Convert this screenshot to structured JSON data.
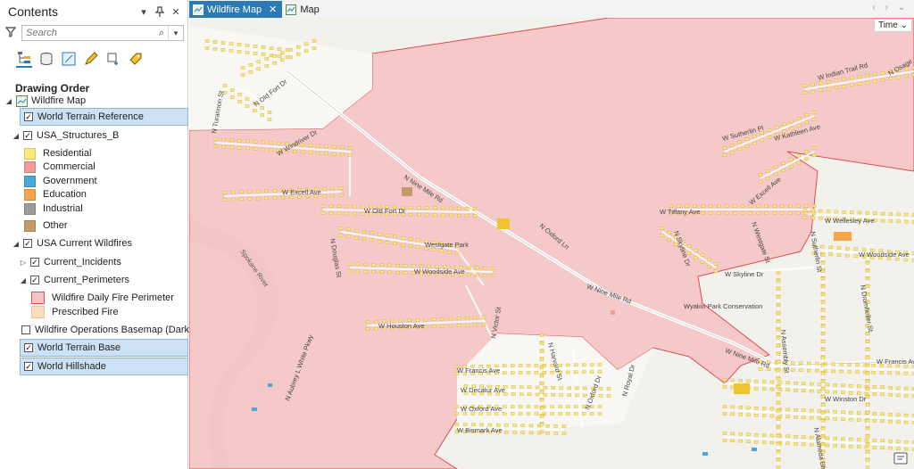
{
  "contents": {
    "title": "Contents",
    "search_placeholder": "Search",
    "drawing_order_label": "Drawing Order",
    "header_icons": [
      "chevron-down-icon",
      "pin-icon",
      "close-icon"
    ],
    "tools": [
      "drawing-order-icon",
      "data-source-icon",
      "selection-icon",
      "editing-icon",
      "snapping-icon",
      "labeling-icon"
    ]
  },
  "layers": {
    "map_name": "Wildfire Map",
    "world_terrain_reference": "World Terrain Reference",
    "usa_structures": "USA_Structures_B",
    "structure_classes": [
      {
        "label": "Residential",
        "color": "#fde87a"
      },
      {
        "label": "Commercial",
        "color": "#f49a9a"
      },
      {
        "label": "Government",
        "color": "#4aa7d9"
      },
      {
        "label": "Education",
        "color": "#f7a54a"
      },
      {
        "label": "Industrial",
        "color": "#9b9b9b"
      },
      {
        "label": "Other",
        "color": "#c59a6b"
      }
    ],
    "usa_current_wildfires": "USA Current Wildfires",
    "current_incidents": "Current_Incidents",
    "current_perimeters": "Current_Perimeters",
    "perimeter_classes": [
      {
        "label": "Wildfire Daily Fire Perimeter",
        "color": "#f4c4c4",
        "border": "#e05050"
      },
      {
        "label": "Prescribed Fire",
        "color": "#f6dcc0",
        "border": "#e8c39c"
      }
    ],
    "basemap_dark": "Wildfire Operations Basemap (Dark)",
    "world_terrain_base": "World Terrain Base",
    "world_hillshade": "World Hillshade"
  },
  "tabs": [
    {
      "label": "Wildfire Map",
      "active": true
    },
    {
      "label": "Map",
      "active": false
    }
  ],
  "time_label": "Time",
  "colors": {
    "accent": "#2a7ab6",
    "fire_fill": "#f5c6c6",
    "fire_edge": "#e04b4b",
    "river": "#cbc8d6",
    "residential": "#fde87a"
  },
  "map_labels": {
    "streets": [
      "N Old Fort Dr",
      "N Turannon St",
      "W Windriver Dr",
      "N Nine Mile Rd",
      "W Excell Ave",
      "W Old Fort Dr",
      "N Douglas St",
      "N Oxford Ln",
      "Westgate Park",
      "W Woodside Ave",
      "W Nine Mile Rd",
      "W Houston Ave",
      "N Victor St",
      "W Francis Ave",
      "N Harvard St",
      "N Oxford Dr",
      "N Royal Dr",
      "W Decatur Ave",
      "W Oxford Ave",
      "W Bismark Ave",
      "Spokane River",
      "N Aubrey L White Pkwy",
      "W Sutherlin Pl",
      "W Kathleen Ave",
      "W Excell Ave",
      "W Tiffany Ave",
      "N Skyline Dr",
      "N Westgate St",
      "W Skyline Dr",
      "Wyakin Park Conservation",
      "W Wellesley Ave",
      "N Sutherlin St",
      "W Woodside Ave",
      "N Drumheller St",
      "N Assembly St",
      "W Nine Mile Rd",
      "W Francis Ave",
      "W Winston Dr",
      "N Alameda Blvd",
      "W Indian Trail Rd",
      "N Osage"
    ]
  }
}
